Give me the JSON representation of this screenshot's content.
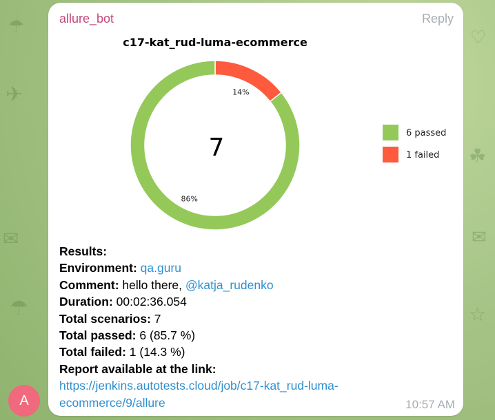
{
  "bot": {
    "name": "allure_bot",
    "reply_label": "Reply",
    "avatar_letter": "A",
    "time": "10:57 AM"
  },
  "chart_data": {
    "type": "pie",
    "title": "c17-kat_rud-luma-ecommerce",
    "center_label": "7",
    "slices": [
      {
        "name": "passed",
        "legend_label": "6 passed",
        "value": 6,
        "percent_label": "86%",
        "color": "#94c95a"
      },
      {
        "name": "failed",
        "legend_label": "1 failed",
        "value": 1,
        "percent_label": "14%",
        "color": "#fd5a3e"
      }
    ]
  },
  "results": {
    "header": "Results:",
    "environment_label": "Environment:",
    "environment_value": "qa.guru",
    "comment_label": "Comment:",
    "comment_text": "hello there,",
    "comment_mention": "@katja_rudenko",
    "duration_label": "Duration:",
    "duration_value": "00:02:36.054",
    "total_scenarios_label": "Total scenarios:",
    "total_scenarios_value": "7",
    "total_passed_label": "Total passed:",
    "total_passed_value": "6 (85.7 %)",
    "total_failed_label": "Total failed:",
    "total_failed_value": "1 (14.3 %)",
    "report_label": "Report available at the link:",
    "report_url_line1": "https://jenkins.autotests.cloud/job/c17-kat_rud-luma-",
    "report_url_line2": "ecommerce/9/allure"
  }
}
